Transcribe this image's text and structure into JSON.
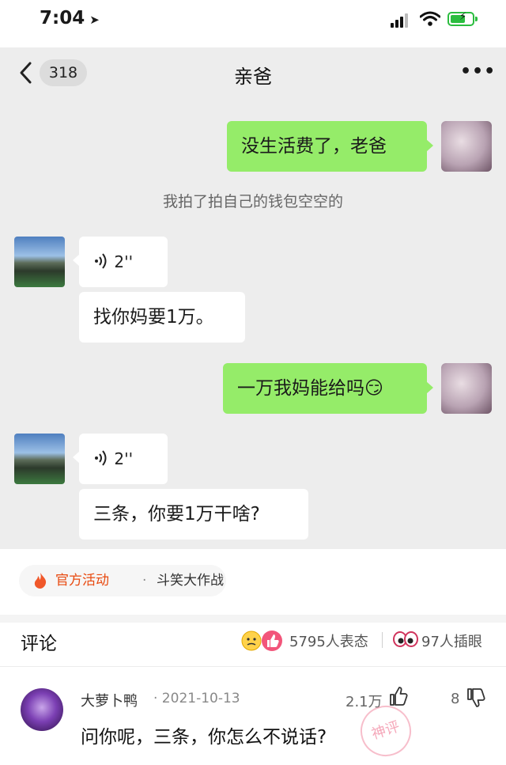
{
  "status_bar": {
    "time": "7:04",
    "location_arrow": "navigation-arrow-icon",
    "battery_color": "#2bbd3f"
  },
  "chat": {
    "back_count": "318",
    "title": "亲爸",
    "system_note": "我拍了拍自己的钱包空空的",
    "messages": [
      {
        "from": "me",
        "text": "没生活费了，老爸"
      },
      {
        "from": "dad",
        "voice": "2''",
        "text": "找你妈要1万。"
      },
      {
        "from": "me",
        "text": "一万我妈能给吗😏"
      },
      {
        "from": "dad",
        "voice": "2''",
        "text": "三条，你要1万干啥?"
      }
    ],
    "colors": {
      "background": "#ededed",
      "my_bubble": "#95ec69",
      "their_bubble": "#ffffff"
    }
  },
  "campaign": {
    "label": "官方活动",
    "separator": "·",
    "name": "斗笑大作战",
    "accent": "#e8490f"
  },
  "comments_section": {
    "title": "评论",
    "reactions": "5795人表态",
    "inserts": "97人插眼"
  },
  "comment": {
    "user": "大萝卜鸭",
    "date": "· 2021-10-13",
    "text": "问你呢，三条，你怎么不说话?",
    "likes": "2.1万",
    "dislikes": "8",
    "stamp": "神评"
  }
}
